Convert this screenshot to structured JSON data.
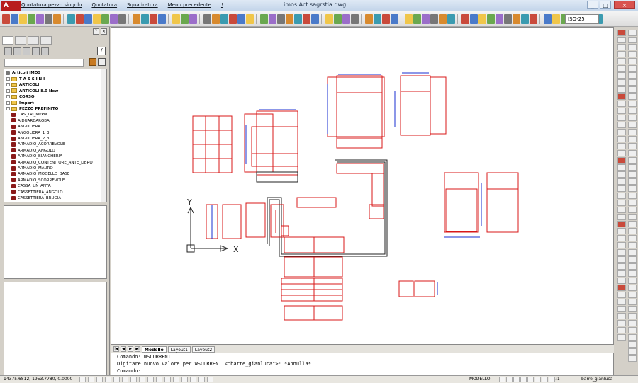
{
  "titlebar": {
    "title": "imos Act    sagrstia.dwg"
  },
  "menu": [
    "Quotatura pezzo singolo",
    "Quotatura",
    "Squadratura",
    "Menu precedente",
    "!"
  ],
  "toolbar": {
    "iso_style": "ISO-25"
  },
  "tree": {
    "root": "Articoli IMOS",
    "folders": [
      "T A S S I N I",
      "ARTICOLI",
      "ARTICOLI 8.0 New",
      "CORSO",
      "Import",
      "PEZZO PREFINITO"
    ],
    "items": [
      "CAS_TRI_MPPM",
      "AIDUARDAROBA",
      "ANGOLIERA",
      "ANGOLIERA_1_3",
      "ANGOLIERA_2_3",
      "ARMADIO_ACORREVOLE",
      "ARMADIO_ANGOLO",
      "ARMADIO_BIANCHERIA",
      "ARMADIO_CONTENITORE_ANTE_LIBRO",
      "ARMADIO_MAURO",
      "ARMADIO_MODELLO_BASE",
      "ARMADIO_SCORREVOLE",
      "CASSA_UN_ANTA",
      "CASSETTIERA_ANGOLO",
      "CASSETTIERA_BRUGIA"
    ]
  },
  "canvas": {
    "axis_y": "Y",
    "axis_x": "X"
  },
  "layout_tabs": [
    "Modello",
    "Layout1",
    "Layout2"
  ],
  "command": {
    "line1": "Comando: WSCURRENT",
    "line2": "Digitare nuovo valore per WSCURRENT <\"barre_gianluca\">: *Annulla*",
    "line3": "Comando:"
  },
  "status": {
    "coords": "14375.6812, 1953.7780, 0.0000",
    "model": "MODELLO",
    "scale": "1:1",
    "workspace": "barre_gianluca"
  },
  "colors": {
    "red": "#d81818",
    "blue": "#1a2fd0",
    "black": "#202020"
  }
}
